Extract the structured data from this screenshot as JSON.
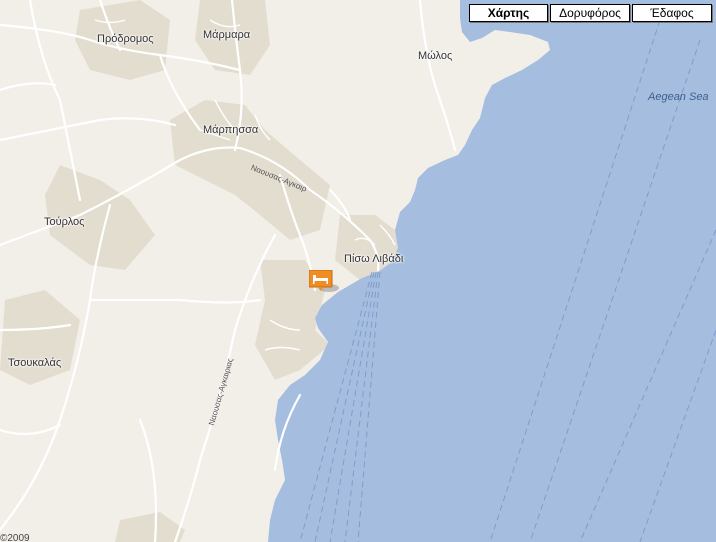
{
  "map_types": {
    "map": "Χάρτης",
    "satellite": "Δορυφόρος",
    "terrain": "Έδαφος",
    "selected": "map"
  },
  "places": {
    "prodromos": "Πρόδρομος",
    "marmara": "Μάρμαρα",
    "marpissa": "Μάρπησσα",
    "molos": "Μώλος",
    "tourlos": "Τούρλος",
    "piso_livadi": "Πίσω Λιβάδι",
    "tsoukalas": "Τσουκαλάς"
  },
  "sea": {
    "aegean": "Aegean Sea"
  },
  "roads": {
    "naousa_agkairias_1": "Ναουσας-Αγκαιρ",
    "naousa_agkairias_2": "Ναουσας-Αγκαιριας"
  },
  "marker": {
    "icon": "hotel-bed-icon",
    "color": "#f08c22"
  },
  "colors": {
    "land": "#f2efe9",
    "sea": "#a5bedf",
    "town": "#e3ddd0",
    "road": "#ffffff"
  },
  "copyright": "©2009"
}
